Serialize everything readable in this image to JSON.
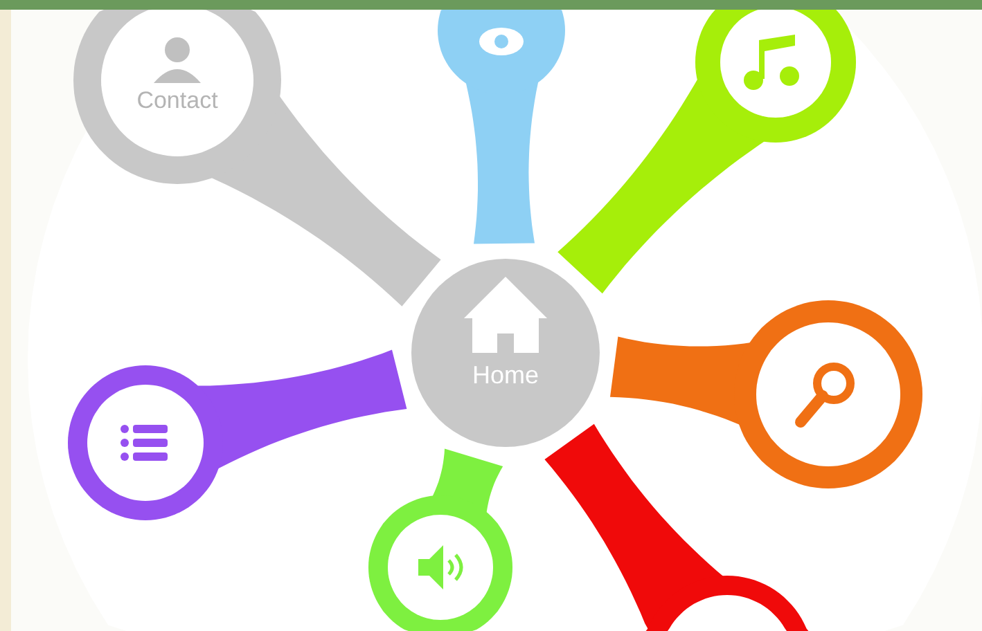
{
  "center": {
    "label": "Home",
    "color": "#c8c8c8"
  },
  "nodes": [
    {
      "kind": "contact",
      "label": "Contact",
      "color": "#c8c8c8"
    },
    {
      "kind": "eye",
      "color": "#8ed0f4"
    },
    {
      "kind": "music",
      "color": "#a6ee0a"
    },
    {
      "kind": "search",
      "color": "#f07014"
    },
    {
      "kind": "blank",
      "color": "#f00a0a"
    },
    {
      "kind": "speaker",
      "color": "#7ef040"
    },
    {
      "kind": "list",
      "color": "#9650f0"
    }
  ]
}
